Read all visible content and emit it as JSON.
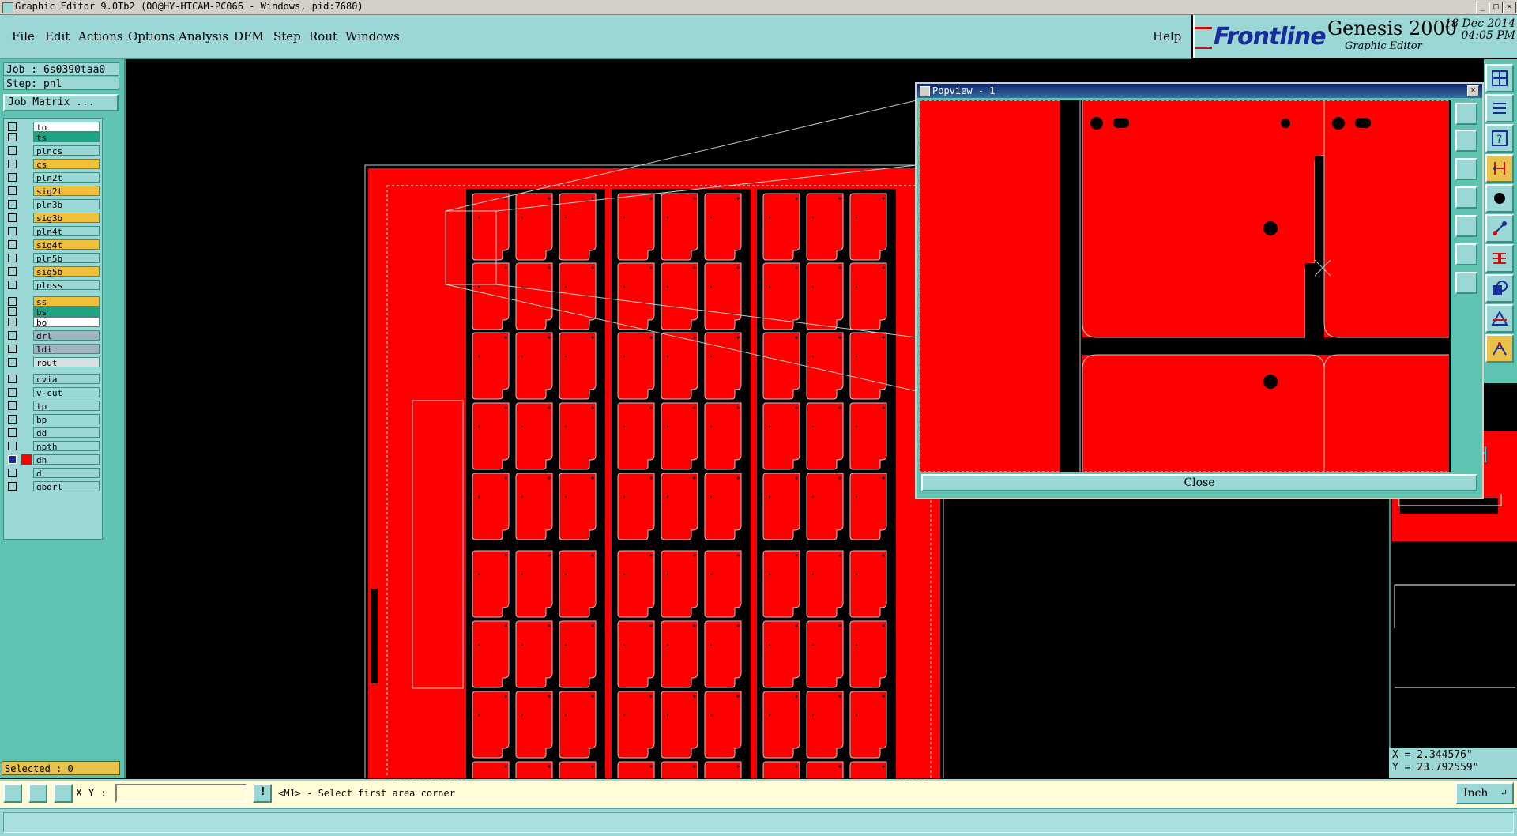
{
  "window": {
    "title": "Graphic Editor 9.0Tb2 (OO@HY-HTCAM-PC066 - Windows, pid:7680)",
    "controls": [
      "_",
      "□",
      "✕"
    ]
  },
  "menu": [
    "File",
    "Edit",
    "Actions",
    "Options",
    "Analysis",
    "DFM",
    "Step",
    "Rout",
    "Windows"
  ],
  "help_label": "Help",
  "brand": {
    "logo_text": "Frontline",
    "product": "Genesis 2000",
    "subtitle": "Graphic Editor",
    "date": "18 Dec 2014",
    "time": "04:05 PM",
    "logo_color": "#1a2d9c",
    "logo_accent": "#d01010"
  },
  "job": {
    "job_label": "Job : 6s0390taa0",
    "step_label": "Step: pnl",
    "job_matrix_button": "Job Matrix ..."
  },
  "layers": [
    {
      "name": "to",
      "color": "#ffffff",
      "group": 0
    },
    {
      "name": "ts",
      "color": "#1fa582",
      "group": 0
    },
    {
      "name": "plncs",
      "color": "#9bd7d5",
      "group": 1
    },
    {
      "name": "cs",
      "color": "#f2bf3b",
      "group": 1
    },
    {
      "name": "pln2t",
      "color": "#9bd7d5",
      "group": 1
    },
    {
      "name": "sig2t",
      "color": "#f2bf3b",
      "group": 1
    },
    {
      "name": "pln3b",
      "color": "#9bd7d5",
      "group": 1
    },
    {
      "name": "sig3b",
      "color": "#f2bf3b",
      "group": 1
    },
    {
      "name": "pln4t",
      "color": "#9bd7d5",
      "group": 1
    },
    {
      "name": "sig4t",
      "color": "#f2bf3b",
      "group": 1
    },
    {
      "name": "pln5b",
      "color": "#9bd7d5",
      "group": 1
    },
    {
      "name": "sig5b",
      "color": "#f2bf3b",
      "group": 1
    },
    {
      "name": "plnss",
      "color": "#9bd7d5",
      "group": 1
    },
    {
      "name": "ss",
      "color": "#f2bf3b",
      "group": 2
    },
    {
      "name": "bs",
      "color": "#1fa582",
      "group": 2
    },
    {
      "name": "bo",
      "color": "#ffffff",
      "group": 2
    },
    {
      "name": "drl",
      "color": "#a0b4c0",
      "group": 3
    },
    {
      "name": "ldi",
      "color": "#a0b4c0",
      "group": 3
    },
    {
      "name": "rout",
      "color": "#d9e0e0",
      "group": 3
    },
    {
      "name": "cvia",
      "color": "#9bd7d5",
      "group": 4
    },
    {
      "name": "v-cut",
      "color": "#9bd7d5",
      "group": 4
    },
    {
      "name": "tp",
      "color": "#9bd7d5",
      "group": 4
    },
    {
      "name": "bp",
      "color": "#9bd7d5",
      "group": 4
    },
    {
      "name": "dd",
      "color": "#9bd7d5",
      "group": 4
    },
    {
      "name": "npth",
      "color": "#9bd7d5",
      "group": 4
    },
    {
      "name": "dh",
      "color": "#9bd7d5",
      "group": 4,
      "active": true
    },
    {
      "name": "d",
      "color": "#9bd7d5",
      "group": 4
    },
    {
      "name": "gbdrl",
      "color": "#9bd7d5",
      "group": 4
    }
  ],
  "selected_label": "Selected : 0",
  "popview": {
    "title": "Popview - 1",
    "close_button": "Close"
  },
  "coords": {
    "x": "X = 2.344576\"",
    "y": "Y = 23.792559\""
  },
  "command": {
    "xy_label": "X Y :",
    "xy_value": "",
    "prompt": "<M1> - Select first area corner",
    "units": "Inch"
  },
  "colors": {
    "panel": "#9bd7d5",
    "panel_dark": "#5ec4b1",
    "copper": "#ff0000",
    "board_outline": "#c8c8c8",
    "highlight": "#e8c24a"
  }
}
